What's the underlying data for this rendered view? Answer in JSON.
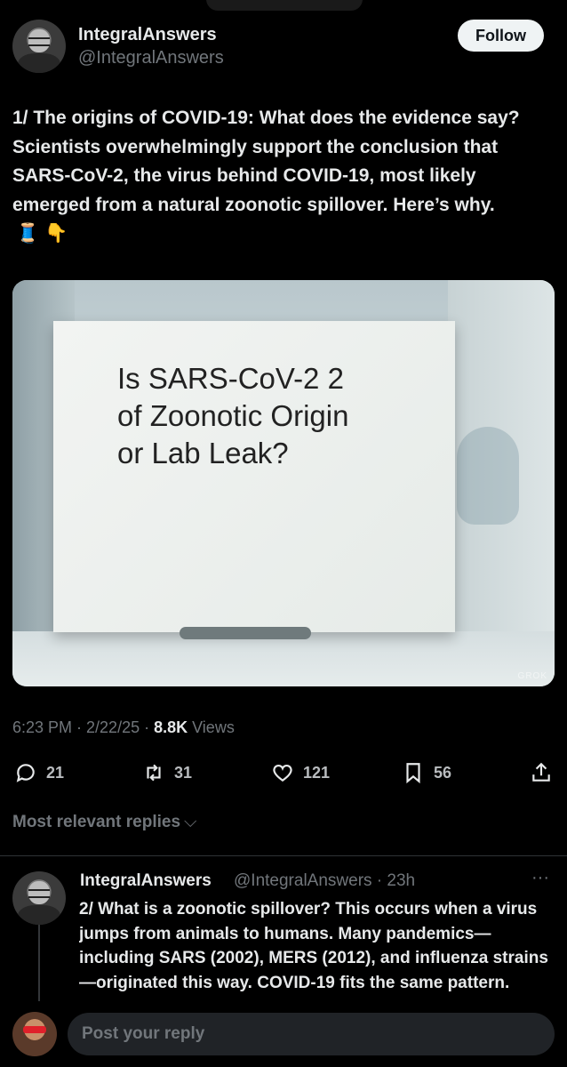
{
  "tweet": {
    "display_name": "IntegralAnswers",
    "handle": "@IntegralAnswers",
    "follow_label": "Follow",
    "text": "1/ The origins of COVID-19: What does the evidence say? Scientists overwhelmingly support the conclusion that SARS-CoV-2, the virus behind COVID-19, most likely emerged from a natural zoonotic spillover. Here’s why.",
    "emojis": "🧵 👇",
    "media": {
      "card_line1": "Is SARS-CoV-2 2",
      "card_line2": "of Zoonotic Origin",
      "card_line3": "or Lab Leak?",
      "watermark": "GROK"
    },
    "time": "6:23 PM · 2/22/25 · ",
    "views_count": "8.8K",
    "views_label": " Views",
    "replies": "21",
    "reposts": "31",
    "likes": "121",
    "bookmarks": "56"
  },
  "replies_filter": {
    "label": "Most relevant replies",
    "chevron": "⌵"
  },
  "reply": {
    "display_name": "IntegralAnswers",
    "handle": "@IntegralAnswers · 23h",
    "more": "···",
    "text": "2/ What is a zoonotic spillover? This occurs when a virus jumps from animals to humans. Many pandemics—including SARS (2002), MERS (2012), and influenza strains—originated this way. COVID-19 fits the same pattern."
  },
  "composer": {
    "placeholder": "Post your reply"
  },
  "colors": {
    "background": "#000000",
    "text": "#e7e9ea",
    "secondary": "#71767b",
    "follow_bg": "#eff3f4"
  },
  "icons": [
    "reply-icon",
    "repost-icon",
    "like-icon",
    "bookmark-icon",
    "share-icon",
    "chevron-down-icon",
    "more-icon"
  ]
}
